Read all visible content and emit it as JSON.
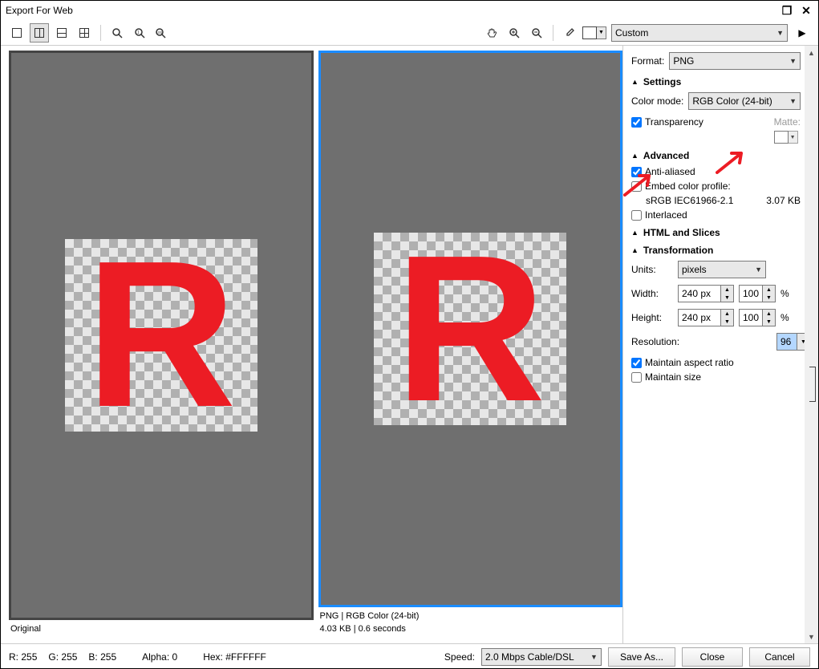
{
  "window": {
    "title": "Export For Web",
    "maximize_glyph": "❐",
    "close_glyph": "✕"
  },
  "preset_combo": "Custom",
  "format": {
    "label": "Format:",
    "value": "PNG"
  },
  "settings": {
    "header": "Settings",
    "color_mode_label": "Color mode:",
    "color_mode_value": "RGB Color (24-bit)",
    "transparency_label": "Transparency",
    "transparency_checked": true,
    "matte_label": "Matte:"
  },
  "advanced": {
    "header": "Advanced",
    "antialiased_label": "Anti-aliased",
    "antialiased_checked": true,
    "embed_label": "Embed color profile:",
    "embed_checked": false,
    "profile_name": "sRGB IEC61966-2.1",
    "profile_size": "3.07 KB",
    "interlaced_label": "Interlaced",
    "interlaced_checked": false
  },
  "html_slices": {
    "header": "HTML and Slices"
  },
  "transformation": {
    "header": "Transformation",
    "units_label": "Units:",
    "units_value": "pixels",
    "width_label": "Width:",
    "width_value": "240 px",
    "width_pct": "100",
    "pct_symbol": "%",
    "height_label": "Height:",
    "height_value": "240 px",
    "height_pct": "100",
    "resolution_label": "Resolution:",
    "resolution_value": "96",
    "maintain_ratio_label": "Maintain aspect ratio",
    "maintain_ratio_checked": true,
    "maintain_size_label": "Maintain size",
    "maintain_size_checked": false
  },
  "preview": {
    "left_caption": "Original",
    "right_caption_line1": "PNG  |  RGB Color (24-bit)",
    "right_caption_line2": "4.03 KB  |  0.6 seconds",
    "letter": "R"
  },
  "status": {
    "r_label": "R:",
    "r": "255",
    "g_label": "G:",
    "g": "255",
    "b_label": "B:",
    "b": "255",
    "alpha_label": "Alpha:",
    "alpha": "0",
    "hex_label": "Hex:",
    "hex": "#FFFFFF",
    "speed_label": "Speed:",
    "speed_value": "2.0 Mbps Cable/DSL"
  },
  "buttons": {
    "save_as": "Save As...",
    "close": "Close",
    "cancel": "Cancel"
  }
}
